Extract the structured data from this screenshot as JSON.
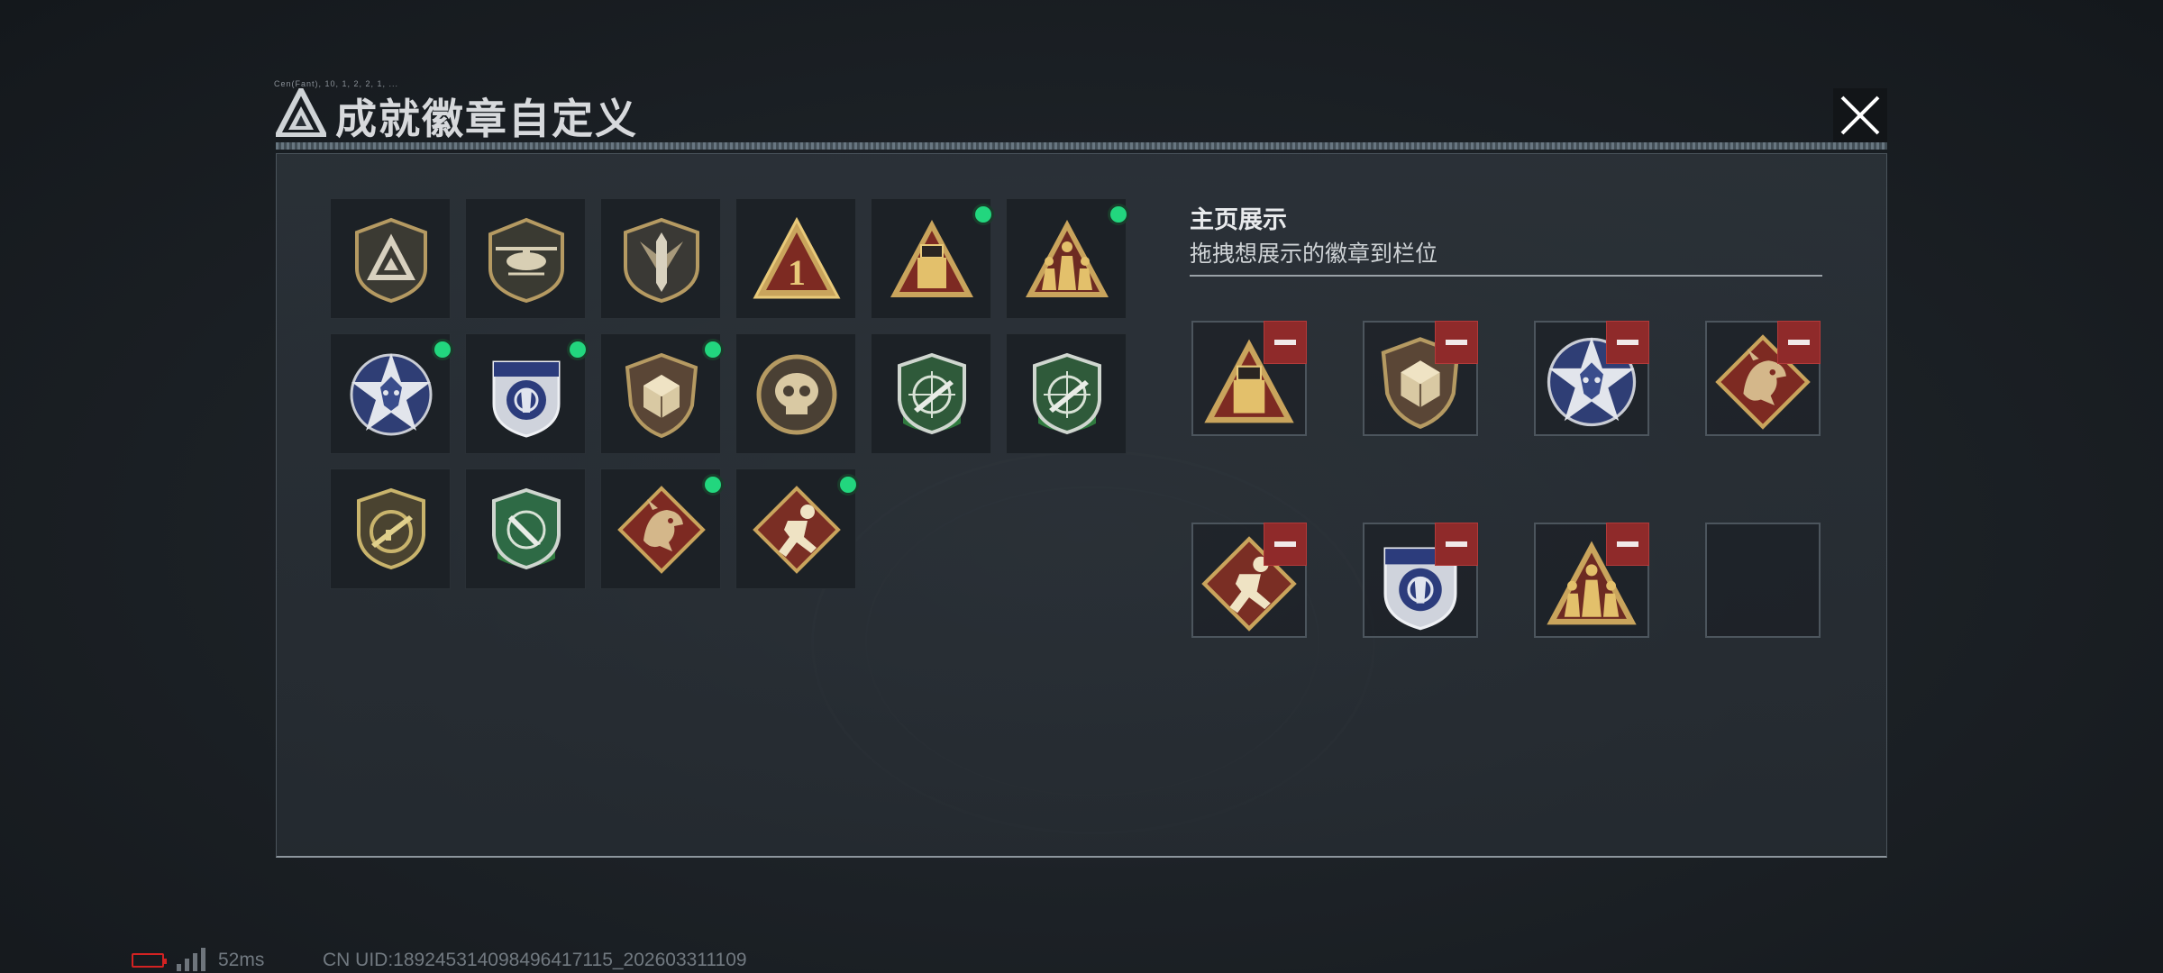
{
  "window": {
    "title": "成就徽章自定义",
    "header_small_text": "Cen(Fant), 10, 1, 2, 2, 1, ..."
  },
  "grid": {
    "badges": [
      {
        "icon": "triangle-emblem-shield-badge",
        "equipped": false
      },
      {
        "icon": "helicopter-shield-badge",
        "equipped": false
      },
      {
        "icon": "sword-wings-shield-badge",
        "equipped": false
      },
      {
        "icon": "number-one-triangle-badge",
        "equipped": false,
        "text": "1"
      },
      {
        "icon": "usb-drive-triangle-badge",
        "equipped": true
      },
      {
        "icon": "squad-triangle-badge",
        "equipped": true
      },
      {
        "icon": "star-wolf-badge",
        "equipped": true
      },
      {
        "icon": "police-wolf-badge",
        "equipped": true
      },
      {
        "icon": "dice-shield-badge",
        "equipped": true
      },
      {
        "icon": "skull-round-badge",
        "equipped": false
      },
      {
        "icon": "green-crosshair-rifle-badge",
        "equipped": false
      },
      {
        "icon": "green-crosshair-rifle-badge-2",
        "equipped": false
      },
      {
        "icon": "gold-rifle-shield-badge",
        "equipped": false
      },
      {
        "icon": "green-knife-shield-badge",
        "equipped": false
      },
      {
        "icon": "dragon-diamond-badge",
        "equipped": true
      },
      {
        "icon": "runner-diamond-badge",
        "equipped": true
      }
    ]
  },
  "showcase": {
    "heading": "主页展示",
    "subtitle": "拖拽想展示的徽章到栏位",
    "slots": [
      {
        "icon": "usb-drive-triangle-badge",
        "filled": true
      },
      {
        "icon": "dice-shield-badge",
        "filled": true
      },
      {
        "icon": "star-wolf-badge",
        "filled": true
      },
      {
        "icon": "dragon-diamond-badge",
        "filled": true
      },
      {
        "icon": "runner-diamond-badge",
        "filled": true
      },
      {
        "icon": "police-wolf-badge",
        "filled": true
      },
      {
        "icon": "squad-triangle-badge",
        "filled": true
      },
      {
        "icon": "",
        "filled": false
      }
    ]
  },
  "status_bar": {
    "ping": "52ms",
    "uid": "CN UID:189245314098496417115_202603311109"
  },
  "colors": {
    "equipped_dot": "#22d67e",
    "remove_button": "#8f2a2a",
    "gold": "#c9a45c",
    "crimson": "#7d2a22"
  }
}
